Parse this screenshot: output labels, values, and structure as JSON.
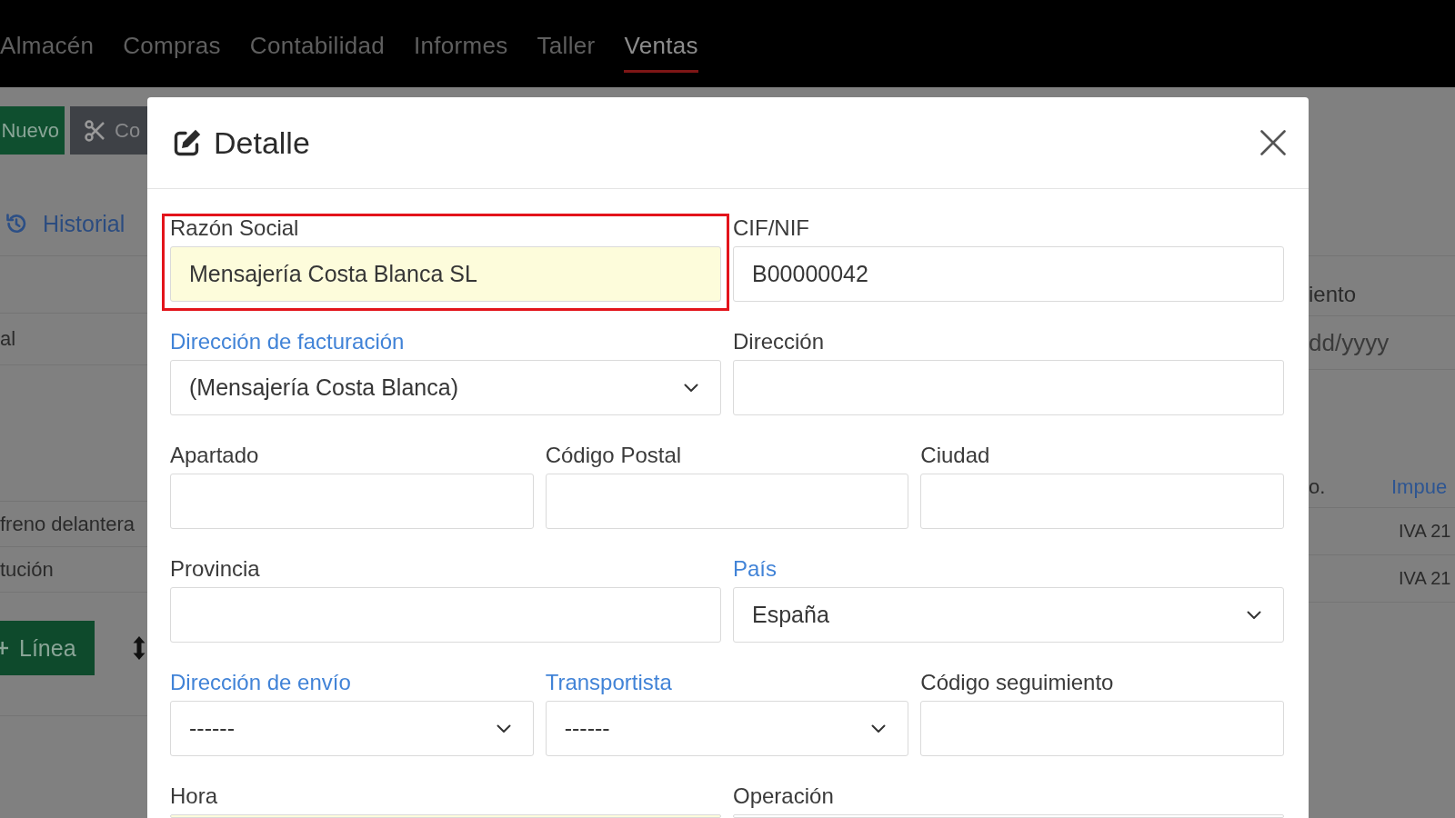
{
  "top_nav": {
    "items": [
      {
        "label": "Almacén",
        "selected": false
      },
      {
        "label": "Compras",
        "selected": false
      },
      {
        "label": "Contabilidad",
        "selected": false
      },
      {
        "label": "Informes",
        "selected": false
      },
      {
        "label": "Taller",
        "selected": false
      },
      {
        "label": "Ventas",
        "selected": true
      }
    ]
  },
  "page_left": {
    "toolbar": [
      {
        "kind": "new",
        "label": "Nuevo"
      },
      {
        "kind": "copy",
        "label": "Co"
      }
    ],
    "history_link": "Historial",
    "field_text": "al",
    "lines": [
      "freno delantera",
      "tución"
    ],
    "add_line_button": "Línea"
  },
  "page_right": {
    "field_label": "iento",
    "date_placeholder": "dd/yyyy",
    "columns": [
      "o.",
      "Impue"
    ],
    "lines": [
      "IVA 21",
      "IVA 21"
    ]
  },
  "modal": {
    "title": "Detalle",
    "rows": [
      [
        {
          "kind": "text",
          "label": "Razón Social",
          "value": "Mensajería Costa Blanca SL",
          "highlighted": true,
          "outlined": true
        },
        {
          "kind": "text",
          "label": "CIF/NIF",
          "value": "B00000042",
          "highlighted": false,
          "outlined": false
        }
      ],
      [
        {
          "kind": "select",
          "label": "Dirección de facturación",
          "value": "(Mensajería Costa Blanca)",
          "highlighted": false,
          "outlined": false
        },
        {
          "kind": "text",
          "label": "Dirección",
          "highlighted": false,
          "outlined": false
        }
      ],
      [
        {
          "kind": "text",
          "label": "Apartado",
          "highlighted": false,
          "outlined": false
        },
        {
          "kind": "text",
          "label": "Código Postal",
          "highlighted": false,
          "outlined": false
        },
        {
          "kind": "text",
          "label": "Ciudad",
          "highlighted": false,
          "outlined": false
        }
      ],
      [
        {
          "kind": "text",
          "label": "Provincia",
          "highlighted": false,
          "outlined": false
        },
        {
          "kind": "select",
          "label": "País",
          "value": "España",
          "highlighted": false,
          "outlined": false
        }
      ],
      [
        {
          "kind": "select",
          "label": "Dirección de envío",
          "value": "------",
          "highlighted": false,
          "outlined": false
        },
        {
          "kind": "select",
          "label": "Transportista",
          "value": "------",
          "highlighted": false,
          "outlined": false
        },
        {
          "kind": "text",
          "label": "Código seguimiento",
          "highlighted": false,
          "outlined": false
        }
      ],
      [
        {
          "kind": "text",
          "label": "Hora",
          "highlighted": true,
          "outlined": false
        },
        {
          "kind": "text",
          "label": "Operación",
          "highlighted": false,
          "outlined": false
        }
      ]
    ]
  }
}
